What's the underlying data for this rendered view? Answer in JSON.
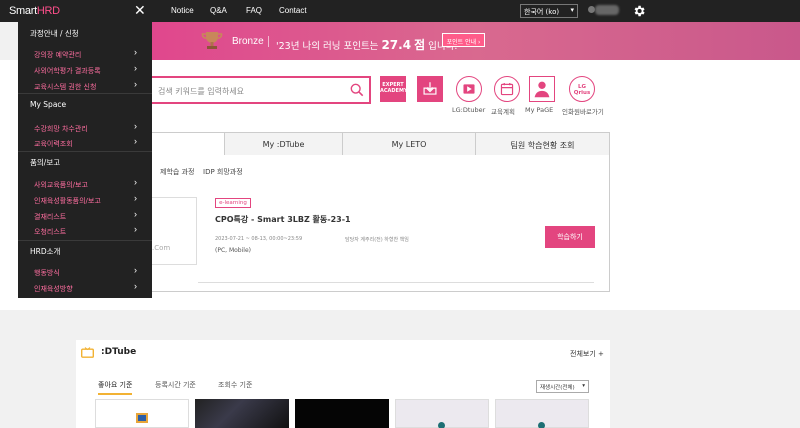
{
  "header": {
    "logo_a": "Smart",
    "logo_b": "HRD",
    "close": "✕",
    "nav": [
      "Notice",
      "Q&A",
      "FAQ",
      "Contact"
    ],
    "language": "한국어 (ko)"
  },
  "banner": {
    "level": "Bronze",
    "text_pre": "'23년 나의 러닝 포인트는",
    "points": "27.4",
    "unit": "점",
    "text_post": "입니다.",
    "button": "포인트 안내 ›"
  },
  "sidebar": {
    "sections": [
      {
        "title": "과정안내 / 신청",
        "items": [
          "강의장 예약관리",
          "사외어학평가 결과등록",
          "교육시스템 권한 신청"
        ]
      },
      {
        "title": "My Space",
        "items": [
          "수강희망 차수관리",
          "교육이력조회"
        ]
      },
      {
        "title": "품의/보고",
        "items": [
          "사외교육품의/보고",
          "인재육성활동품의/보고",
          "결재리스트",
          "오청리스트"
        ]
      },
      {
        "title": "HRD소개",
        "items": [
          "행동방식",
          "인재육성방향"
        ]
      }
    ]
  },
  "search": {
    "placeholder": "검색 키워드를 입력하세요"
  },
  "quick_links": {
    "expert_a": "EXPERT",
    "expert_b": "ACADEMY",
    "dtuber": "LG:Dtuber",
    "plan": "교육계획",
    "mypage": "My PaGE",
    "qrius": "LG Qrius",
    "qrius_label": "인화원바로가기"
  },
  "tabs": [
    "",
    "My :DTube",
    "My LETO",
    "팀원 학습현황 조회"
  ],
  "subtabs": [
    "제학습 과정",
    "IDP 희망과정"
  ],
  "course": {
    "badge": "e-learning",
    "title": "CPO특강 - Smart 3LBZ 활동-23-1",
    "period": "2023-07-21 ~ 08-13, 00:00~23:59",
    "org": "담당자 계주리(전) 하형찬 책임",
    "device": "(PC, Mobile)",
    "thumb_text": ".Com",
    "button": "학습하기"
  },
  "dtube": {
    "title": ":DTube",
    "view_all": "전체보기 +",
    "sort_tabs": [
      "좋아요 기준",
      "등록시간 기준",
      "조회수 기준"
    ],
    "sort_select": "재생시간(전체)"
  },
  "colors": {
    "accent": "#e3457f",
    "topbar": "#222222"
  }
}
